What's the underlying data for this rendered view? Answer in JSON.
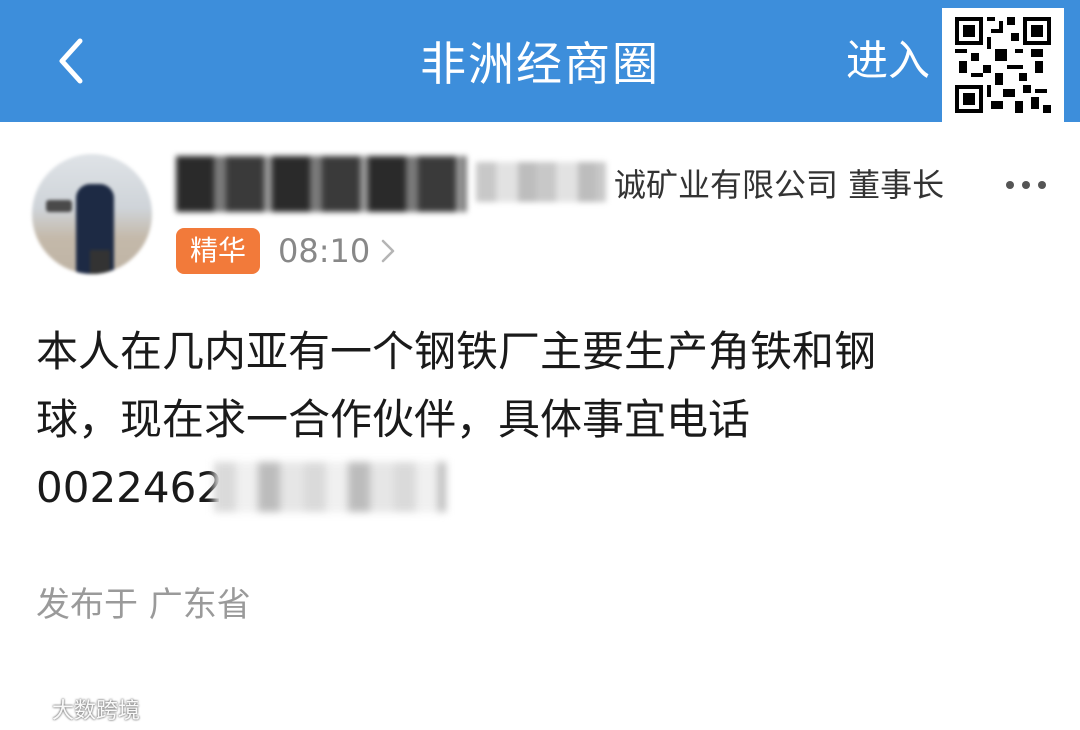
{
  "header": {
    "title": "非洲经商圈",
    "enter_label": "进入",
    "back_icon": "chevron-left-icon",
    "qr_icon": "qr-code-icon",
    "background_color": "#3d8edb"
  },
  "post": {
    "author_company": "诚矿业有限公司 董事长",
    "badge": "精华",
    "badge_color": "#f27a3a",
    "time": "08:10",
    "content_lines": [
      "本人在几内亚有一个钢铁厂主要生产角铁和钢",
      "球，现在求一合作伙伴，具体事宜电话",
      "0022462"
    ],
    "location": "发布于 广东省"
  },
  "watermark": {
    "text": "大数跨境"
  }
}
